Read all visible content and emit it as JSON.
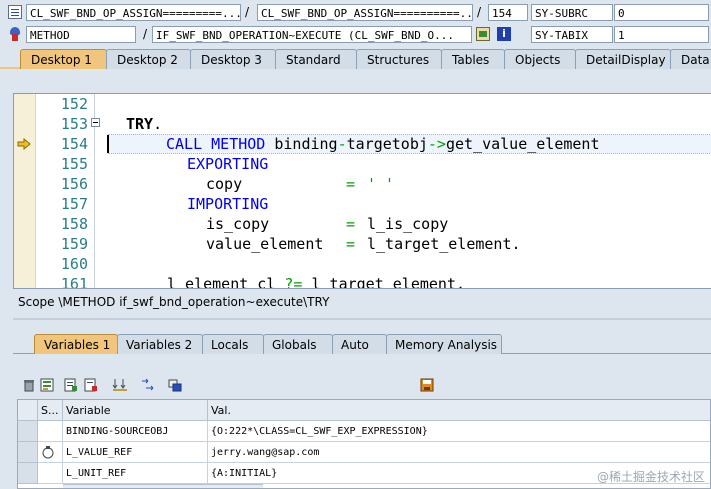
{
  "toolbar": {
    "row1": {
      "field1": "CL_SWF_BND_OP_ASSIGN=========...",
      "sep1": "/",
      "field2": "CL_SWF_BND_OP_ASSIGN==========...",
      "sep2": "/",
      "line": "154",
      "sysvar": "SY-SUBRC",
      "sysval": "0"
    },
    "row2": {
      "type": "METHOD",
      "sep": "/",
      "name": "IF_SWF_BND_OPERATION~EXECUTE (CL_SWF_BND_O...",
      "sysvar": "SY-TABIX",
      "sysval": "1"
    }
  },
  "tabs": [
    "Desktop 1",
    "Desktop 2",
    "Desktop 3",
    "Standard",
    "Structures",
    "Tables",
    "Objects",
    "DetailDisplay",
    "Data"
  ],
  "editor": {
    "lines": [
      {
        "num": "152"
      },
      {
        "num": "153",
        "kw": "TRY",
        "rest": "."
      },
      {
        "num": "154",
        "kw": "CALL METHOD",
        "rest": " binding",
        "op": "-",
        "rest2": "targetobj",
        "op2": "->",
        "rest3": "get_value_element"
      },
      {
        "num": "155",
        "kw": "EXPORTING"
      },
      {
        "num": "156",
        "name": "copy",
        "op": "=",
        "str": "' '"
      },
      {
        "num": "157",
        "kw": "IMPORTING"
      },
      {
        "num": "158",
        "name": "is_copy",
        "op": "=",
        "val": "l_is_copy"
      },
      {
        "num": "159",
        "name": "value_element",
        "op": "=",
        "val": "l_target_element."
      },
      {
        "num": "160"
      },
      {
        "num": "161",
        "text": "l element cl ",
        "op": "?=",
        "text2": " l target element."
      }
    ]
  },
  "scope": "Scope \\METHOD if_swf_bnd_operation~execute\\TRY",
  "var_tabs": [
    "Variables 1",
    "Variables 2",
    "Locals",
    "Globals",
    "Auto",
    "Memory Analysis"
  ],
  "grid": {
    "headers": {
      "s": "S...",
      "variable": "Variable",
      "value": "Val."
    },
    "rows": [
      {
        "variable": "BINDING-SOURCEOBJ",
        "value": "{O:222*\\CLASS=CL_SWF_EXP_EXPRESSION}"
      },
      {
        "variable": "L_VALUE_REF",
        "value": "jerry.wang@sap.com"
      },
      {
        "variable": "L_UNIT_REF",
        "value": "{A:INITIAL}"
      }
    ]
  },
  "watermark": "@稀土掘金技术社区",
  "colors": {
    "active_tab": "#f2c57c",
    "keyword": "#0000ee",
    "operator": "#00a000",
    "line_number": "#2a7c86"
  }
}
